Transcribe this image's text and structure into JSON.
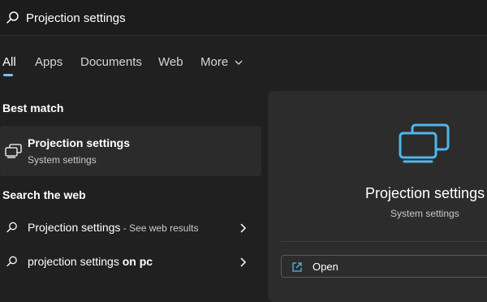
{
  "search": {
    "value": "Projection settings"
  },
  "tabs": [
    {
      "label": "All",
      "active": true
    },
    {
      "label": "Apps"
    },
    {
      "label": "Documents"
    },
    {
      "label": "Web"
    },
    {
      "label": "More"
    }
  ],
  "best_match": {
    "heading": "Best match",
    "title": "Projection settings",
    "subtitle": "System settings",
    "icon": "projection-icon"
  },
  "web": {
    "heading": "Search the web",
    "results": [
      {
        "text": "Projection settings",
        "suffix": " - See web results"
      },
      {
        "text": "projection settings ",
        "bold": "on pc"
      }
    ]
  },
  "preview": {
    "title": "Projection settings",
    "subtitle": "System settings",
    "actions": [
      {
        "label": "Open",
        "icon": "open-external-icon"
      }
    ]
  },
  "colors": {
    "accent": "#7fc0ec",
    "background": "#202020",
    "card": "#2b2b2b"
  }
}
